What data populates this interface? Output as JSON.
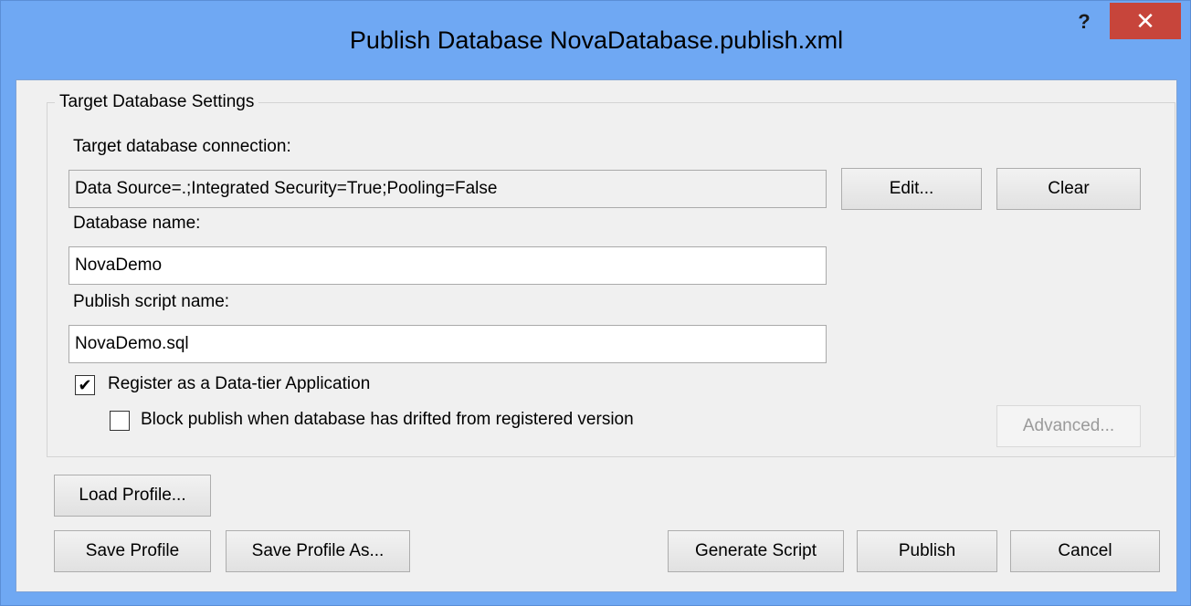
{
  "window": {
    "title": "Publish Database NovaDatabase.publish.xml",
    "help_label": "?",
    "close_label": "✕"
  },
  "settings": {
    "group_title": "Target Database Settings",
    "connection_label": "Target database connection:",
    "connection_value": "Data Source=.;Integrated Security=True;Pooling=False",
    "edit_button": "Edit...",
    "clear_button": "Clear",
    "database_name_label": "Database name:",
    "database_name_value": "NovaDemo",
    "script_name_label": "Publish script name:",
    "script_name_value": "NovaDemo.sql",
    "register_label": "Register as a Data-tier Application",
    "register_checked": true,
    "register_mark": "✔",
    "block_label": "Block publish when database has drifted from registered version",
    "block_checked": false,
    "advanced_button": "Advanced..."
  },
  "footer": {
    "load_profile": "Load Profile...",
    "save_profile": "Save Profile",
    "save_profile_as": "Save Profile As...",
    "generate_script": "Generate Script",
    "publish": "Publish",
    "cancel": "Cancel"
  },
  "colors": {
    "title_bar": "#6fa8f3",
    "close_button": "#c7453b",
    "dialog_background": "#f0f0f0"
  }
}
